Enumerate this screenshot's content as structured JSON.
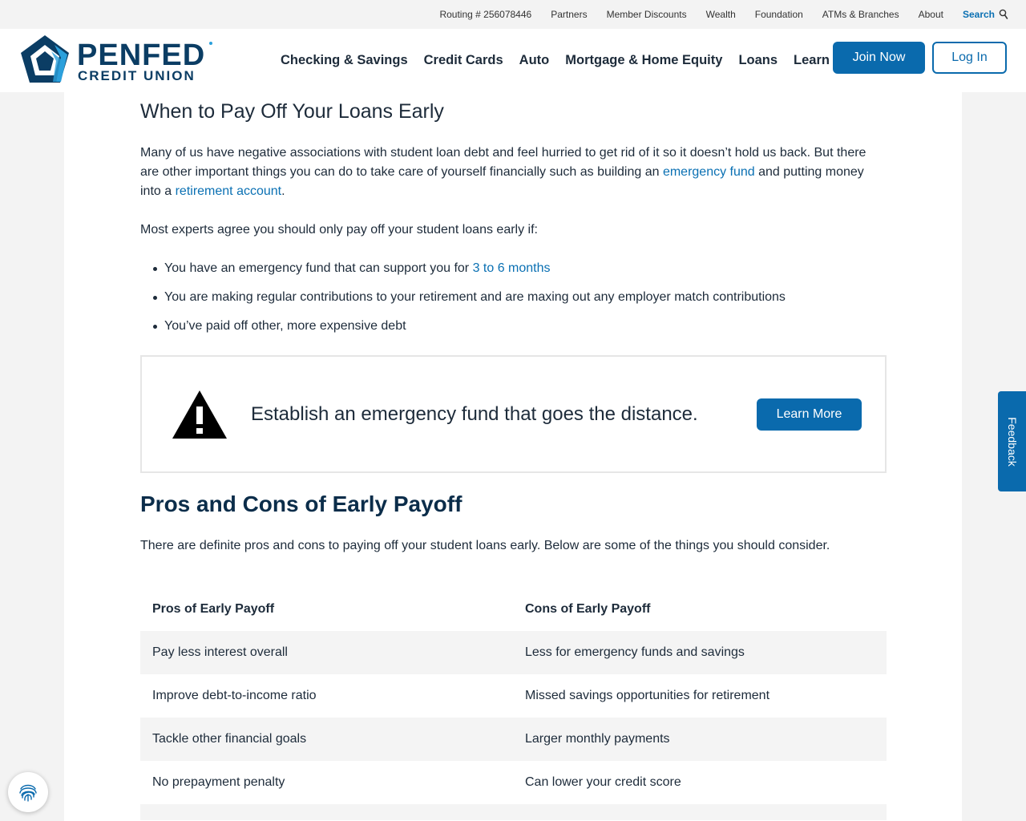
{
  "utility_bar": {
    "routing": "Routing # 256078446",
    "links": [
      "Partners",
      "Member Discounts",
      "Wealth",
      "Foundation",
      "ATMs & Branches",
      "About"
    ],
    "search_label": "Search"
  },
  "header": {
    "logo_line1": "PENFED",
    "logo_line2": "CREDIT UNION",
    "nav": [
      "Checking & Savings",
      "Credit Cards",
      "Auto",
      "Mortgage & Home Equity",
      "Loans",
      "Learn"
    ],
    "join_label": "Join Now",
    "login_label": "Log In"
  },
  "article": {
    "subheading": "When to Pay Off Your Loans Early",
    "para1_a": "Many of us have negative associations with student loan debt and feel hurried to get rid of it so it doesn’t hold us back. But there are other important things you can do to take care of yourself financially such as building an ",
    "para1_link1": "emergency fund",
    "para1_b": " and putting money into a ",
    "para1_link2": "retirement account",
    "para1_c": ".",
    "para2": "Most experts agree you should only pay off your student loans early if:",
    "bullet1_text": "You have an emergency fund that can support you for ",
    "bullet1_link": "3 to 6 months",
    "bullet2": "You are making regular contributions to your retirement and are maxing out any employer match contributions",
    "bullet3": "You’ve paid off other, more expensive debt",
    "callout_text": "Establish an emergency fund that goes the distance.",
    "callout_button": "Learn More",
    "main_heading": "Pros and Cons of Early Payoff",
    "para3": "There are definite pros and cons to paying off your student loans early. Below are some of the things you should consider.",
    "table": {
      "headers": [
        "Pros of Early Payoff",
        "Cons of Early Payoff"
      ],
      "rows": [
        [
          "Pay less interest overall",
          "Less for emergency funds and savings"
        ],
        [
          "Improve debt-to-income ratio",
          "Missed savings opportunities for retirement"
        ],
        [
          "Tackle other financial goals",
          "Larger monthly payments"
        ],
        [
          "No prepayment penalty",
          "Can lower your credit score"
        ]
      ]
    }
  },
  "feedback_label": "Feedback",
  "colors": {
    "brand_blue": "#0a6aad",
    "link_blue": "#0a70b3",
    "navy": "#0b3d64"
  }
}
